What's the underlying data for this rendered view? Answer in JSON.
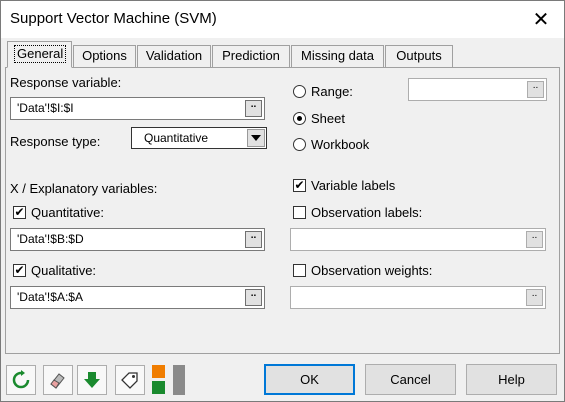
{
  "window": {
    "title": "Support Vector Machine (SVM)",
    "close_glyph": "✕"
  },
  "tabs": [
    {
      "label": "General",
      "active": true
    },
    {
      "label": "Options"
    },
    {
      "label": "Validation"
    },
    {
      "label": "Prediction"
    },
    {
      "label": "Missing data"
    },
    {
      "label": "Outputs"
    }
  ],
  "general": {
    "response_variable_label": "Response variable:",
    "response_variable_value": "'Data'!$I:$I",
    "response_type_label": "Response type:",
    "response_type_value": "Quantitative",
    "x_label": "X / Explanatory variables:",
    "quantitative_label": "Quantitative:",
    "quantitative_checked": true,
    "quantitative_value": "'Data'!$B:$D",
    "qualitative_label": "Qualitative:",
    "qualitative_checked": true,
    "qualitative_value": "'Data'!$A:$A",
    "output_options": [
      {
        "label": "Range:",
        "selected": false
      },
      {
        "label": "Sheet",
        "selected": true
      },
      {
        "label": "Workbook",
        "selected": false
      }
    ],
    "range_value": "",
    "variable_labels_label": "Variable labels",
    "variable_labels_checked": true,
    "observation_labels_label": "Observation labels:",
    "observation_labels_checked": false,
    "observation_labels_value": "",
    "observation_weights_label": "Observation weights:",
    "observation_weights_checked": false,
    "observation_weights_value": "",
    "ellipsis_glyph": "..",
    "check_glyph": "✔"
  },
  "footer": {
    "ok_label": "OK",
    "cancel_label": "Cancel",
    "help_label": "Help"
  },
  "colors": {
    "accent_orange": "#f07d00",
    "accent_green": "#1a8a2e",
    "gray_block": "#8a8a8a",
    "focus_blue": "#0078d7"
  }
}
